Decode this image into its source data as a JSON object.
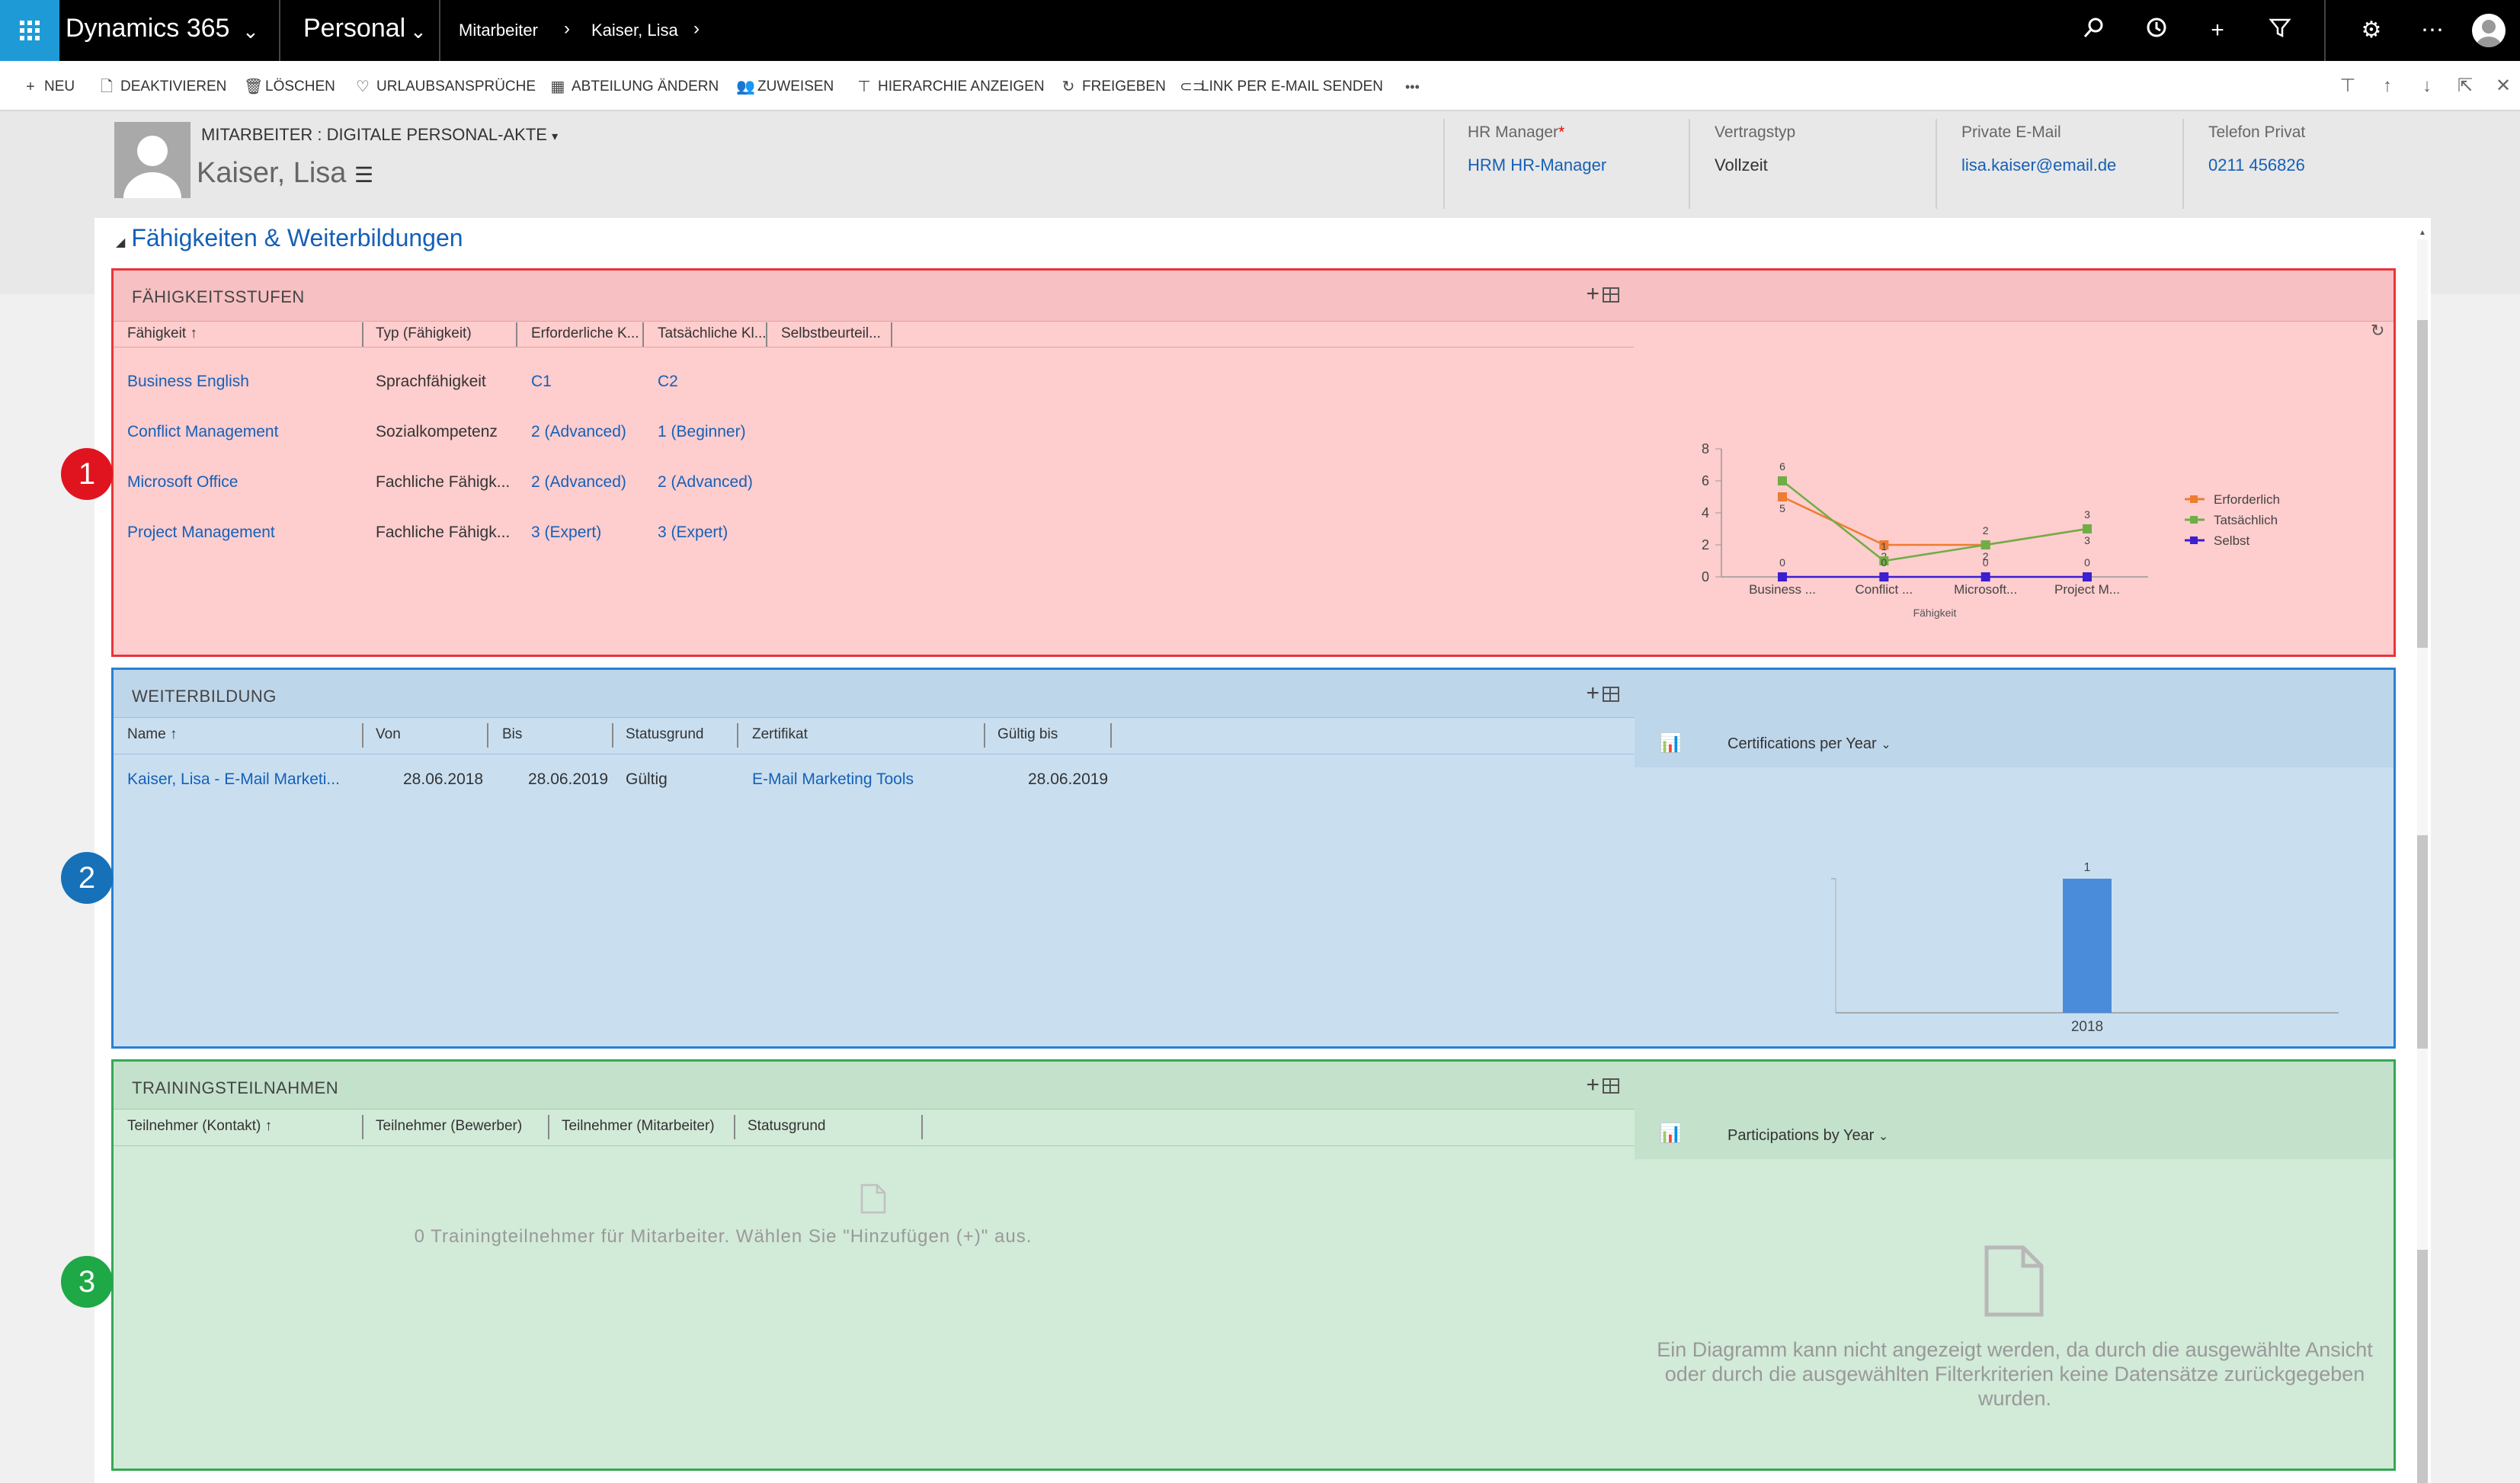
{
  "topnav": {
    "app_title": "Dynamics 365",
    "area": "Personal",
    "breadcrumb": [
      "Mitarbeiter",
      "Kaiser, Lisa"
    ]
  },
  "commands": {
    "items": [
      {
        "label": "NEU",
        "icon": "plus-icon"
      },
      {
        "label": "DEAKTIVIEREN",
        "icon": "document-icon"
      },
      {
        "label": "LÖSCHEN",
        "icon": "trash-icon"
      },
      {
        "label": "URLAUBSANSPRÜCHE",
        "icon": "heart-icon"
      },
      {
        "label": "ABTEILUNG ÄNDERN",
        "icon": "building-icon"
      },
      {
        "label": "ZUWEISEN",
        "icon": "assign-icon"
      },
      {
        "label": "HIERARCHIE ANZEIGEN",
        "icon": "hierarchy-icon"
      },
      {
        "label": "FREIGEBEN",
        "icon": "share-icon"
      },
      {
        "label": "LINK PER E-MAIL SENDEN",
        "icon": "link-icon"
      }
    ],
    "more": "•••"
  },
  "header": {
    "entity_label": "MITARBEITER : DIGITALE PERSONAL-AKTE",
    "name": "Kaiser, Lisa",
    "fields": [
      {
        "label": "HR Manager",
        "value": "HRM HR-Manager",
        "link": true,
        "required": true
      },
      {
        "label": "Vertragstyp",
        "value": "Vollzeit",
        "link": false,
        "required": false
      },
      {
        "label": "Private E-Mail",
        "value": "lisa.kaiser@email.de",
        "link": true,
        "required": false
      },
      {
        "label": "Telefon Privat",
        "value": "0211 456826",
        "link": true,
        "required": false
      }
    ]
  },
  "section": {
    "title": "Fähigkeiten & Weiterbildungen"
  },
  "skills": {
    "title": "FÄHIGKEITSSTUFEN",
    "columns": [
      "Fähigkeit ↑",
      "Typ (Fähigkeit)",
      "Erforderliche K...",
      "Tatsächliche Kl...",
      "Selbstbeurteil..."
    ],
    "rows": [
      {
        "name": "Business English",
        "type": "Sprachfähigkeit",
        "required": "C1",
        "actual": "C2"
      },
      {
        "name": "Conflict Management",
        "type": "Sozialkompetenz",
        "required": "2 (Advanced)",
        "actual": "1 (Beginner)"
      },
      {
        "name": "Microsoft Office",
        "type": "Fachliche Fähigk...",
        "required": "2 (Advanced)",
        "actual": "2 (Advanced)"
      },
      {
        "name": "Project Management",
        "type": "Fachliche Fähigk...",
        "required": "3 (Expert)",
        "actual": "3 (Expert)"
      }
    ]
  },
  "training": {
    "title": "WEITERBILDUNG",
    "columns": [
      "Name ↑",
      "Von",
      "Bis",
      "Statusgrund",
      "Zertifikat",
      "Gültig bis"
    ],
    "rows": [
      {
        "name": "Kaiser, Lisa  - E-Mail Marketi...",
        "from": "28.06.2018",
        "to": "28.06.2019",
        "status": "Gültig",
        "cert": "E-Mail Marketing Tools",
        "valid": "28.06.2019"
      }
    ],
    "chart_title": "Certifications per Year"
  },
  "participations": {
    "title": "TRAININGSTEILNAHMEN",
    "columns": [
      "Teilnehmer (Kontakt) ↑",
      "Teilnehmer (Bewerber)",
      "Teilnehmer (Mitarbeiter)",
      "Statusgrund"
    ],
    "empty_message": "0 Trainingteilnehmer für Mitarbeiter. Wählen Sie \"Hinzufügen (+)\" aus.",
    "chart_title": "Participations by Year",
    "chart_empty": "Ein Diagramm kann nicht angezeigt werden, da durch die ausgewählte Ansicht oder durch die ausgewählten Filterkriterien keine Datensätze zurückgegeben wurden."
  },
  "badges": [
    "1",
    "2",
    "3"
  ],
  "colors": {
    "nav_bg": "#000000",
    "accent": "#1e9bd7",
    "link": "#1560b7",
    "panel_red": "#fecdce",
    "panel_blue": "#c9dff0",
    "panel_green": "#d2ead8",
    "badge_red": "#e0141e",
    "badge_blue": "#1671b8",
    "badge_green": "#1ea846"
  },
  "chart_data": [
    {
      "type": "line",
      "title": "",
      "xlabel": "Fähigkeit",
      "ylabel": "",
      "categories": [
        "Business ...",
        "Conflict ...",
        "Microsoft...",
        "Project M..."
      ],
      "ylim": [
        0,
        8
      ],
      "yticks": [
        0,
        2,
        4,
        6,
        8
      ],
      "legend_position": "right",
      "series": [
        {
          "name": "Erforderlich",
          "color": "#ed7d31",
          "values": [
            5,
            2,
            2,
            3
          ]
        },
        {
          "name": "Tatsächlich",
          "color": "#70ad47",
          "values": [
            6,
            1,
            2,
            3
          ]
        },
        {
          "name": "Selbst",
          "color": "#3b1fd0",
          "values": [
            0,
            0,
            0,
            0
          ]
        }
      ]
    },
    {
      "type": "bar",
      "title": "Certifications per Year",
      "categories": [
        "2018"
      ],
      "values": [
        1
      ],
      "ylim": [
        0,
        1
      ],
      "color": "#4a8cda"
    }
  ]
}
